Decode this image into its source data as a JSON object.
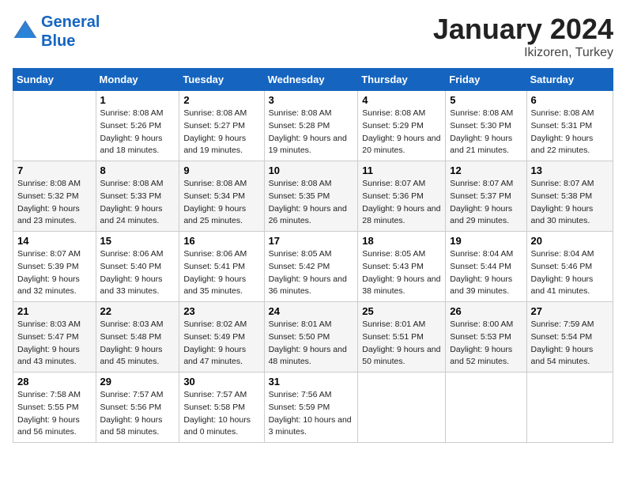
{
  "header": {
    "logo_line1": "General",
    "logo_line2": "Blue",
    "month": "January 2024",
    "location": "Ikizoren, Turkey"
  },
  "weekdays": [
    "Sunday",
    "Monday",
    "Tuesday",
    "Wednesday",
    "Thursday",
    "Friday",
    "Saturday"
  ],
  "weeks": [
    [
      {
        "day": "",
        "sunrise": "",
        "sunset": "",
        "daylight": ""
      },
      {
        "day": "1",
        "sunrise": "Sunrise: 8:08 AM",
        "sunset": "Sunset: 5:26 PM",
        "daylight": "Daylight: 9 hours and 18 minutes."
      },
      {
        "day": "2",
        "sunrise": "Sunrise: 8:08 AM",
        "sunset": "Sunset: 5:27 PM",
        "daylight": "Daylight: 9 hours and 19 minutes."
      },
      {
        "day": "3",
        "sunrise": "Sunrise: 8:08 AM",
        "sunset": "Sunset: 5:28 PM",
        "daylight": "Daylight: 9 hours and 19 minutes."
      },
      {
        "day": "4",
        "sunrise": "Sunrise: 8:08 AM",
        "sunset": "Sunset: 5:29 PM",
        "daylight": "Daylight: 9 hours and 20 minutes."
      },
      {
        "day": "5",
        "sunrise": "Sunrise: 8:08 AM",
        "sunset": "Sunset: 5:30 PM",
        "daylight": "Daylight: 9 hours and 21 minutes."
      },
      {
        "day": "6",
        "sunrise": "Sunrise: 8:08 AM",
        "sunset": "Sunset: 5:31 PM",
        "daylight": "Daylight: 9 hours and 22 minutes."
      }
    ],
    [
      {
        "day": "7",
        "sunrise": "Sunrise: 8:08 AM",
        "sunset": "Sunset: 5:32 PM",
        "daylight": "Daylight: 9 hours and 23 minutes."
      },
      {
        "day": "8",
        "sunrise": "Sunrise: 8:08 AM",
        "sunset": "Sunset: 5:33 PM",
        "daylight": "Daylight: 9 hours and 24 minutes."
      },
      {
        "day": "9",
        "sunrise": "Sunrise: 8:08 AM",
        "sunset": "Sunset: 5:34 PM",
        "daylight": "Daylight: 9 hours and 25 minutes."
      },
      {
        "day": "10",
        "sunrise": "Sunrise: 8:08 AM",
        "sunset": "Sunset: 5:35 PM",
        "daylight": "Daylight: 9 hours and 26 minutes."
      },
      {
        "day": "11",
        "sunrise": "Sunrise: 8:07 AM",
        "sunset": "Sunset: 5:36 PM",
        "daylight": "Daylight: 9 hours and 28 minutes."
      },
      {
        "day": "12",
        "sunrise": "Sunrise: 8:07 AM",
        "sunset": "Sunset: 5:37 PM",
        "daylight": "Daylight: 9 hours and 29 minutes."
      },
      {
        "day": "13",
        "sunrise": "Sunrise: 8:07 AM",
        "sunset": "Sunset: 5:38 PM",
        "daylight": "Daylight: 9 hours and 30 minutes."
      }
    ],
    [
      {
        "day": "14",
        "sunrise": "Sunrise: 8:07 AM",
        "sunset": "Sunset: 5:39 PM",
        "daylight": "Daylight: 9 hours and 32 minutes."
      },
      {
        "day": "15",
        "sunrise": "Sunrise: 8:06 AM",
        "sunset": "Sunset: 5:40 PM",
        "daylight": "Daylight: 9 hours and 33 minutes."
      },
      {
        "day": "16",
        "sunrise": "Sunrise: 8:06 AM",
        "sunset": "Sunset: 5:41 PM",
        "daylight": "Daylight: 9 hours and 35 minutes."
      },
      {
        "day": "17",
        "sunrise": "Sunrise: 8:05 AM",
        "sunset": "Sunset: 5:42 PM",
        "daylight": "Daylight: 9 hours and 36 minutes."
      },
      {
        "day": "18",
        "sunrise": "Sunrise: 8:05 AM",
        "sunset": "Sunset: 5:43 PM",
        "daylight": "Daylight: 9 hours and 38 minutes."
      },
      {
        "day": "19",
        "sunrise": "Sunrise: 8:04 AM",
        "sunset": "Sunset: 5:44 PM",
        "daylight": "Daylight: 9 hours and 39 minutes."
      },
      {
        "day": "20",
        "sunrise": "Sunrise: 8:04 AM",
        "sunset": "Sunset: 5:46 PM",
        "daylight": "Daylight: 9 hours and 41 minutes."
      }
    ],
    [
      {
        "day": "21",
        "sunrise": "Sunrise: 8:03 AM",
        "sunset": "Sunset: 5:47 PM",
        "daylight": "Daylight: 9 hours and 43 minutes."
      },
      {
        "day": "22",
        "sunrise": "Sunrise: 8:03 AM",
        "sunset": "Sunset: 5:48 PM",
        "daylight": "Daylight: 9 hours and 45 minutes."
      },
      {
        "day": "23",
        "sunrise": "Sunrise: 8:02 AM",
        "sunset": "Sunset: 5:49 PM",
        "daylight": "Daylight: 9 hours and 47 minutes."
      },
      {
        "day": "24",
        "sunrise": "Sunrise: 8:01 AM",
        "sunset": "Sunset: 5:50 PM",
        "daylight": "Daylight: 9 hours and 48 minutes."
      },
      {
        "day": "25",
        "sunrise": "Sunrise: 8:01 AM",
        "sunset": "Sunset: 5:51 PM",
        "daylight": "Daylight: 9 hours and 50 minutes."
      },
      {
        "day": "26",
        "sunrise": "Sunrise: 8:00 AM",
        "sunset": "Sunset: 5:53 PM",
        "daylight": "Daylight: 9 hours and 52 minutes."
      },
      {
        "day": "27",
        "sunrise": "Sunrise: 7:59 AM",
        "sunset": "Sunset: 5:54 PM",
        "daylight": "Daylight: 9 hours and 54 minutes."
      }
    ],
    [
      {
        "day": "28",
        "sunrise": "Sunrise: 7:58 AM",
        "sunset": "Sunset: 5:55 PM",
        "daylight": "Daylight: 9 hours and 56 minutes."
      },
      {
        "day": "29",
        "sunrise": "Sunrise: 7:57 AM",
        "sunset": "Sunset: 5:56 PM",
        "daylight": "Daylight: 9 hours and 58 minutes."
      },
      {
        "day": "30",
        "sunrise": "Sunrise: 7:57 AM",
        "sunset": "Sunset: 5:58 PM",
        "daylight": "Daylight: 10 hours and 0 minutes."
      },
      {
        "day": "31",
        "sunrise": "Sunrise: 7:56 AM",
        "sunset": "Sunset: 5:59 PM",
        "daylight": "Daylight: 10 hours and 3 minutes."
      },
      {
        "day": "",
        "sunrise": "",
        "sunset": "",
        "daylight": ""
      },
      {
        "day": "",
        "sunrise": "",
        "sunset": "",
        "daylight": ""
      },
      {
        "day": "",
        "sunrise": "",
        "sunset": "",
        "daylight": ""
      }
    ]
  ]
}
